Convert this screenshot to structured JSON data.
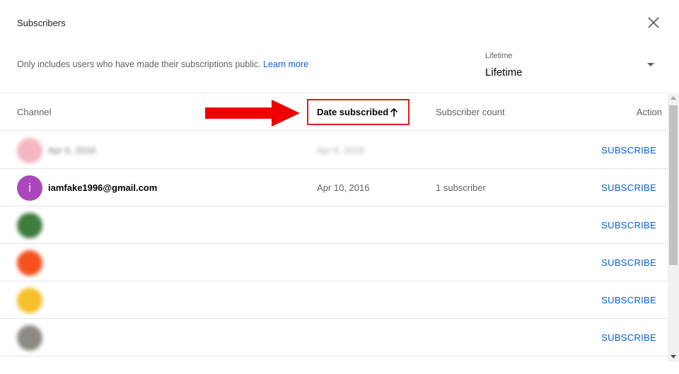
{
  "dialog": {
    "title": "Subscribers",
    "description": "Only includes users who have made their subscriptions public.",
    "learn_more": "Learn more",
    "close_icon": "close-icon"
  },
  "filter": {
    "label": "Lifetime",
    "value": "Lifetime"
  },
  "table": {
    "headers": {
      "channel": "Channel",
      "date": "Date subscribed",
      "subscribers": "Subscriber count",
      "action": "Action"
    },
    "sort": "ascending",
    "rows": [
      {
        "name": "Apr 6, 2016",
        "date": "Apr 6, 2016",
        "count": "",
        "action": "SUBSCRIBE",
        "blurred": true,
        "avatar_color": "#f4b6c2",
        "initial": ""
      },
      {
        "name": "iamfake1996@gmail.com",
        "date": "Apr 10, 2016",
        "count": "1 subscriber",
        "action": "SUBSCRIBE",
        "blurred": false,
        "avatar_color": "#ab47bc",
        "initial": "i"
      },
      {
        "name": "",
        "date": "",
        "count": "",
        "action": "SUBSCRIBE",
        "blurred": true,
        "avatar_color": "#3e7d3c",
        "initial": ""
      },
      {
        "name": "",
        "date": "",
        "count": "",
        "action": "SUBSCRIBE",
        "blurred": true,
        "avatar_color": "#f4511e",
        "initial": ""
      },
      {
        "name": "",
        "date": "",
        "count": "",
        "action": "SUBSCRIBE",
        "blurred": true,
        "avatar_color": "#f6c02a",
        "initial": ""
      },
      {
        "name": "",
        "date": "",
        "count": "",
        "action": "SUBSCRIBE",
        "blurred": true,
        "avatar_color": "#8d8a85",
        "initial": ""
      }
    ]
  },
  "colors": {
    "accent": "#065fd4",
    "highlight": "#e0191e"
  }
}
